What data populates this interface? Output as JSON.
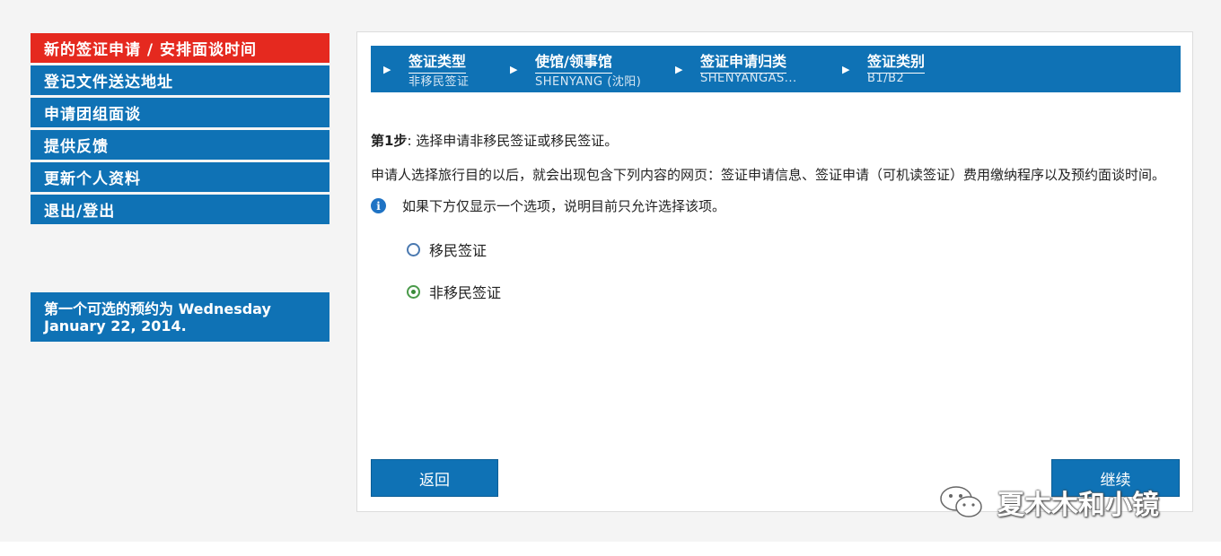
{
  "sidebar": {
    "items": [
      {
        "label": "新的签证申请 / 安排面谈时间",
        "active": true
      },
      {
        "label": "登记文件送达地址",
        "active": false
      },
      {
        "label": "申请团组面谈",
        "active": false
      },
      {
        "label": "提供反馈",
        "active": false
      },
      {
        "label": "更新个人资料",
        "active": false
      },
      {
        "label": "退出/登出",
        "active": false
      }
    ],
    "appointment": "第一个可选的预约为 Wednesday January 22, 2014."
  },
  "steps": [
    {
      "title": "签证类型",
      "value": "非移民签证"
    },
    {
      "title": "使馆/领事馆",
      "value": "SHENYANG (沈阳)"
    },
    {
      "title": "签证申请归类",
      "value": "SHENYANGAS..."
    },
    {
      "title": "签证类别",
      "value": "B1/B2"
    }
  ],
  "content": {
    "step_label": "第1步",
    "step_text": ": 选择申请非移民签证或移民签证。",
    "description": "申请人选择旅行目的以后，就会出现包含下列内容的网页：签证申请信息、签证申请（可机读签证）费用缴纳程序以及预约面谈时间。",
    "note": "如果下方仅显示一个选项，说明目前只允许选择该项。",
    "options": [
      {
        "label": "移民签证",
        "checked": false
      },
      {
        "label": "非移民签证",
        "checked": true
      }
    ]
  },
  "buttons": {
    "back": "返回",
    "continue": "继续"
  },
  "watermark": "夏木木和小镜",
  "colors": {
    "primary": "#0f72b5",
    "active": "#e5291f",
    "background": "#f4f4f4"
  }
}
